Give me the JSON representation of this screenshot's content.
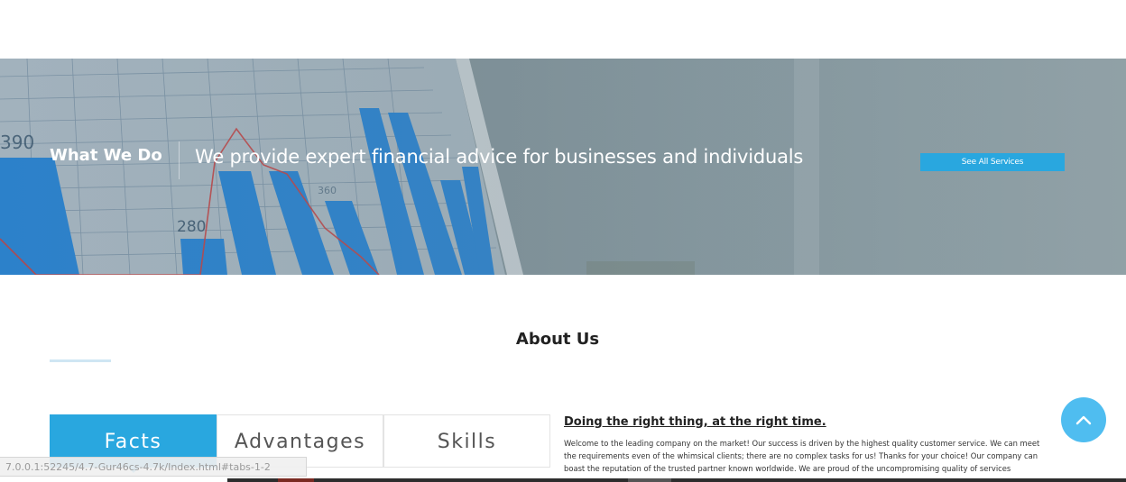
{
  "banner": {
    "heading": "What We Do",
    "tagline": "We provide expert financial advice for businesses and individuals",
    "button_label": "See All Services",
    "chart_labels": [
      "390",
      "280",
      "360"
    ]
  },
  "about": {
    "title": "About Us"
  },
  "tabs": [
    {
      "label": "Facts",
      "active": true
    },
    {
      "label": "Advantages",
      "active": false
    },
    {
      "label": "Skills",
      "active": false
    }
  ],
  "content": {
    "heading": "Doing the right thing, at the right time.",
    "lines": [
      "Welcome to the leading company on the market! Our success is driven by the highest quality customer service. We can meet",
      "the requirements even of the whimsical clients; there are no complex tasks for us! Thanks for your choice! Our company can",
      "boast the reputation of the trusted partner known worldwide. We are proud of the uncompromising quality of services"
    ]
  },
  "status_bar": {
    "url": "7.0.0.1:52245/4.7-Gur46cs-4.7k/Index.html#tabs-1-2"
  },
  "icons": {
    "back_to_top": "chevron-up-icon"
  },
  "colors": {
    "accent": "#29a7df",
    "back_to_top": "#4fbdf0"
  }
}
